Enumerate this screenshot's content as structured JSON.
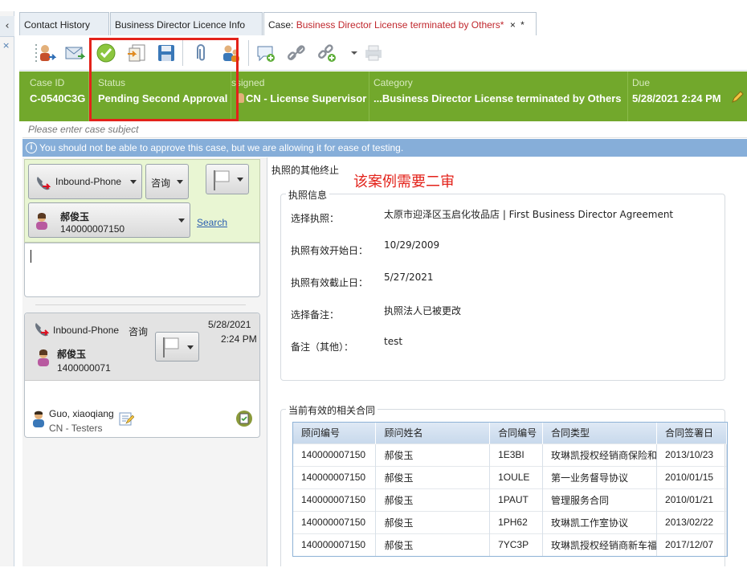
{
  "tabs": [
    {
      "label": "Contact History"
    },
    {
      "label": "Business Director Licence Info"
    },
    {
      "prefix": "Case: ",
      "title": "Business Director License terminated by Others*",
      "close": "×",
      "extra": "*"
    }
  ],
  "toolbar": {
    "icons": [
      "assign-user-icon",
      "email-icon",
      "approve-check-icon",
      "copy-notes-icon",
      "save-disk-icon",
      "attachment-icon",
      "users-transfer-icon",
      "comment-add-icon",
      "link-icon",
      "link-add-icon",
      "dropdown-icon",
      "print-icon"
    ]
  },
  "header": {
    "case_id": {
      "label": "Case ID",
      "value": "C-0540C3G"
    },
    "status": {
      "label": "Status",
      "value": "Pending Second Approval"
    },
    "assigned": {
      "label": "Assigned",
      "value": "CN - License Supervisor"
    },
    "category": {
      "label": "Category",
      "value": "...Business Director License terminated by Others"
    },
    "due": {
      "label": "Due",
      "value": "5/28/2021 2:24 PM"
    }
  },
  "subject_placeholder": "Please enter case subject",
  "info_message": "You should not be able to approve this case, but we are allowing it for ease of testing.",
  "compose": {
    "channel": "Inbound-Phone",
    "type": "咨询",
    "contact_name": "郝俊玉",
    "contact_id": "140000007150",
    "search": "Search"
  },
  "interaction": {
    "channel": "Inbound-Phone",
    "type": "咨询",
    "date": "5/28/2021",
    "time": "2:24 PM",
    "contact_name": "郝俊玉",
    "contact_id": "1400000071",
    "agent_name": "Guo, xiaoqiang",
    "agent_team": "CN - Testers"
  },
  "detail": {
    "title": "执照的其他终止",
    "note": "该案例需要二审",
    "license_section": "执照信息",
    "fields": [
      {
        "label": "选择执照：",
        "value": "太原市迎泽区玉启化妆品店 | First Business Director Agreement"
      },
      {
        "label": "执照有效开始日：",
        "value": "10/29/2009"
      },
      {
        "label": "执照有效截止日：",
        "value": "5/27/2021"
      },
      {
        "label": "选择备注：",
        "value": "执照法人已被更改"
      },
      {
        "label": "备注（其他）：",
        "value": "test"
      }
    ],
    "contracts_section": "当前有效的相关合同",
    "columns": [
      "顾问编号",
      "顾问姓名",
      "合同编号",
      "合同类型",
      "合同签署日"
    ],
    "rows": [
      [
        "140000007150",
        "郝俊玉",
        "1E3BI",
        "玫琳凯授权经销商保险和",
        "2013/10/23"
      ],
      [
        "140000007150",
        "郝俊玉",
        "1OULE",
        "第一业务督导协议",
        "2010/01/15"
      ],
      [
        "140000007150",
        "郝俊玉",
        "1PAUT",
        "管理服务合同",
        "2010/01/21"
      ],
      [
        "140000007150",
        "郝俊玉",
        "1PH62",
        "玫琳凯工作室协议",
        "2013/02/22"
      ],
      [
        "140000007150",
        "郝俊玉",
        "7YC3P",
        "玫琳凯授权经销商新车福",
        "2017/12/07"
      ]
    ]
  },
  "colors": {
    "green": "#72a82c",
    "highlight": "#e3221a",
    "info": "#86aed9"
  }
}
